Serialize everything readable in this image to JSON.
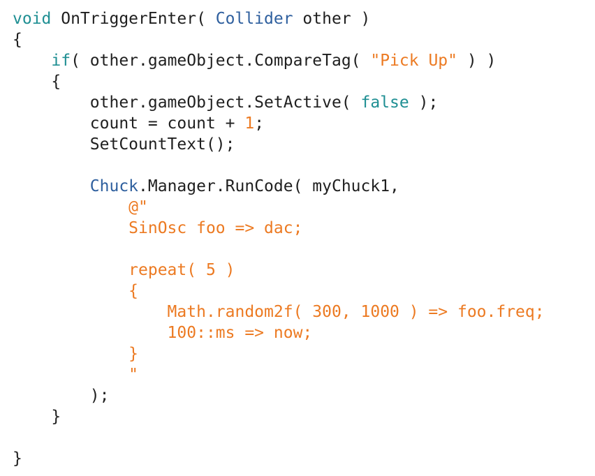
{
  "code_editor": {
    "lines": [
      [
        {
          "t": "void",
          "c": "kw"
        },
        {
          "t": " OnTriggerEnter( ",
          "c": "pl"
        },
        {
          "t": "Collider",
          "c": "ty"
        },
        {
          "t": " other )",
          "c": "pl"
        }
      ],
      [
        {
          "t": "{",
          "c": "pl"
        }
      ],
      [
        {
          "t": "    ",
          "c": "pl"
        },
        {
          "t": "if",
          "c": "kw"
        },
        {
          "t": "( other.gameObject.CompareTag( ",
          "c": "pl"
        },
        {
          "t": "\"Pick Up\"",
          "c": "str"
        },
        {
          "t": " ) )",
          "c": "pl"
        }
      ],
      [
        {
          "t": "    {",
          "c": "pl"
        }
      ],
      [
        {
          "t": "        other.gameObject.SetActive( ",
          "c": "pl"
        },
        {
          "t": "false",
          "c": "kw"
        },
        {
          "t": " );",
          "c": "pl"
        }
      ],
      [
        {
          "t": "        count = count + ",
          "c": "pl"
        },
        {
          "t": "1",
          "c": "num"
        },
        {
          "t": ";",
          "c": "pl"
        }
      ],
      [
        {
          "t": "        SetCountText();",
          "c": "pl"
        }
      ],
      [
        {
          "t": "",
          "c": "pl"
        }
      ],
      [
        {
          "t": "        ",
          "c": "pl"
        },
        {
          "t": "Chuck",
          "c": "ty"
        },
        {
          "t": ".Manager.RunCode( myChuck1,",
          "c": "pl"
        }
      ],
      [
        {
          "t": "            @\"",
          "c": "str"
        }
      ],
      [
        {
          "t": "            SinOsc foo => dac;",
          "c": "str"
        }
      ],
      [
        {
          "t": "",
          "c": "pl"
        }
      ],
      [
        {
          "t": "            repeat( 5 )",
          "c": "str"
        }
      ],
      [
        {
          "t": "            {",
          "c": "str"
        }
      ],
      [
        {
          "t": "                Math.random2f( 300, 1000 ) => foo.freq;",
          "c": "str"
        }
      ],
      [
        {
          "t": "                100::ms => now;",
          "c": "str"
        }
      ],
      [
        {
          "t": "            }",
          "c": "str"
        }
      ],
      [
        {
          "t": "            \"",
          "c": "str"
        }
      ],
      [
        {
          "t": "        );",
          "c": "pl"
        }
      ],
      [
        {
          "t": "    }",
          "c": "pl"
        }
      ],
      [
        {
          "t": "",
          "c": "pl"
        }
      ],
      [
        {
          "t": "}",
          "c": "pl"
        }
      ]
    ],
    "colors": {
      "keyword": "#1f8f93",
      "type": "#2e5f9e",
      "string": "#ec7a22",
      "number": "#ec7a22",
      "plain": "#1f1f1f",
      "background": "#ffffff"
    }
  }
}
